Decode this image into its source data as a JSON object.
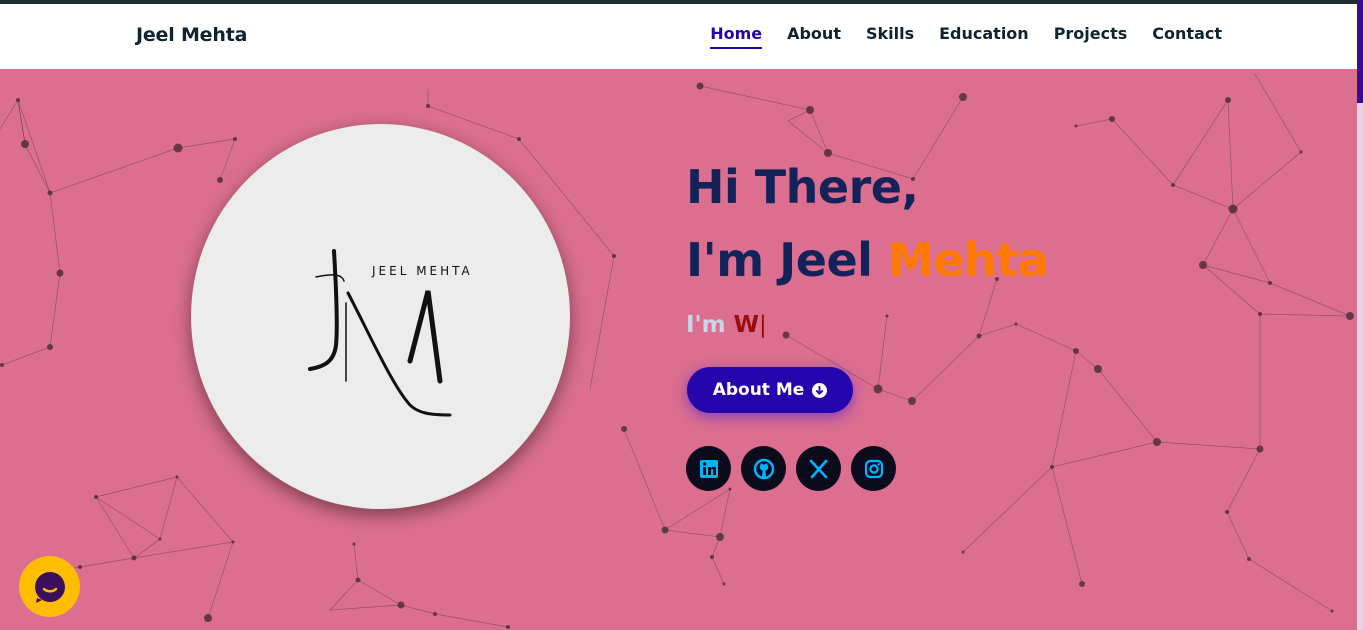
{
  "brand": {
    "name": "Jeel Mehta"
  },
  "nav": {
    "items": [
      {
        "label": "Home",
        "active": true
      },
      {
        "label": "About",
        "active": false
      },
      {
        "label": "Skills",
        "active": false
      },
      {
        "label": "Education",
        "active": false
      },
      {
        "label": "Projects",
        "active": false
      },
      {
        "label": "Contact",
        "active": false
      }
    ]
  },
  "hero": {
    "greeting": "Hi There,",
    "name_prefix": "I'm Jeel ",
    "name_accent": "Mehta",
    "typing_prefix": "I'm ",
    "typing_text": "W",
    "typing_cursor": "|",
    "cta_label": "About Me",
    "logo_text": "JEEL MEHTA"
  },
  "socials": [
    {
      "icon": "linkedin-icon"
    },
    {
      "icon": "github-icon"
    },
    {
      "icon": "x-twitter-icon"
    },
    {
      "icon": "instagram-icon"
    }
  ],
  "colors": {
    "background": "#dc6f8f",
    "accent": "#2506ad",
    "name_accent": "#ff7a00",
    "heading": "#13235a",
    "icon": "#00b4ff"
  }
}
